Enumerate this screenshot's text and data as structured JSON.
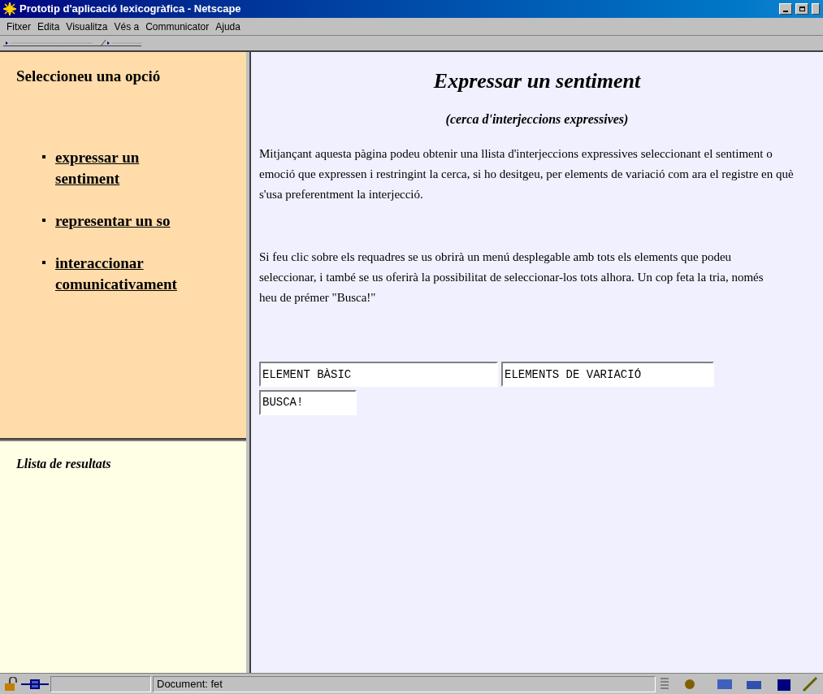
{
  "window": {
    "title": "Prototip d'aplicació lexicogràfica - Netscape"
  },
  "menu": [
    "Fitxer",
    "Edita",
    "Visualitza",
    "Vés a",
    "Communicator",
    "Ajuda"
  ],
  "sidebar": {
    "heading": "Seleccioneu una opció",
    "links": [
      "expressar un sentiment",
      "representar un so",
      "interaccionar comunicativament"
    ]
  },
  "results": {
    "heading": "Llista de resultats"
  },
  "content": {
    "title": "Expressar un sentiment",
    "subtitle": "(cerca d'interjeccions expressives)",
    "paragraphs": [
      "Mitjançant aquesta pàgina podeu obtenir una llista d'interjeccions expressives seleccionant el sentiment o emoció que expressen i restringint la cerca, si ho desitgeu, per elements de variació com ara el registre en què s'usa preferentment la interjecció.",
      "Si feu clic sobre els requadres se us obrirà un menú desplegable amb tots els elements que podeu seleccionar, i també se us oferirà la possibilitat de seleccionar-los tots alhora. Un cop feta la tria, només heu de prémer \"Busca!\""
    ],
    "fields": [
      "ELEMENT BÀSIC",
      "ELEMENTS DE VARIACIÓ"
    ],
    "search_button": "BUSCA!"
  },
  "status_bar": {
    "text": "Document: fet"
  }
}
